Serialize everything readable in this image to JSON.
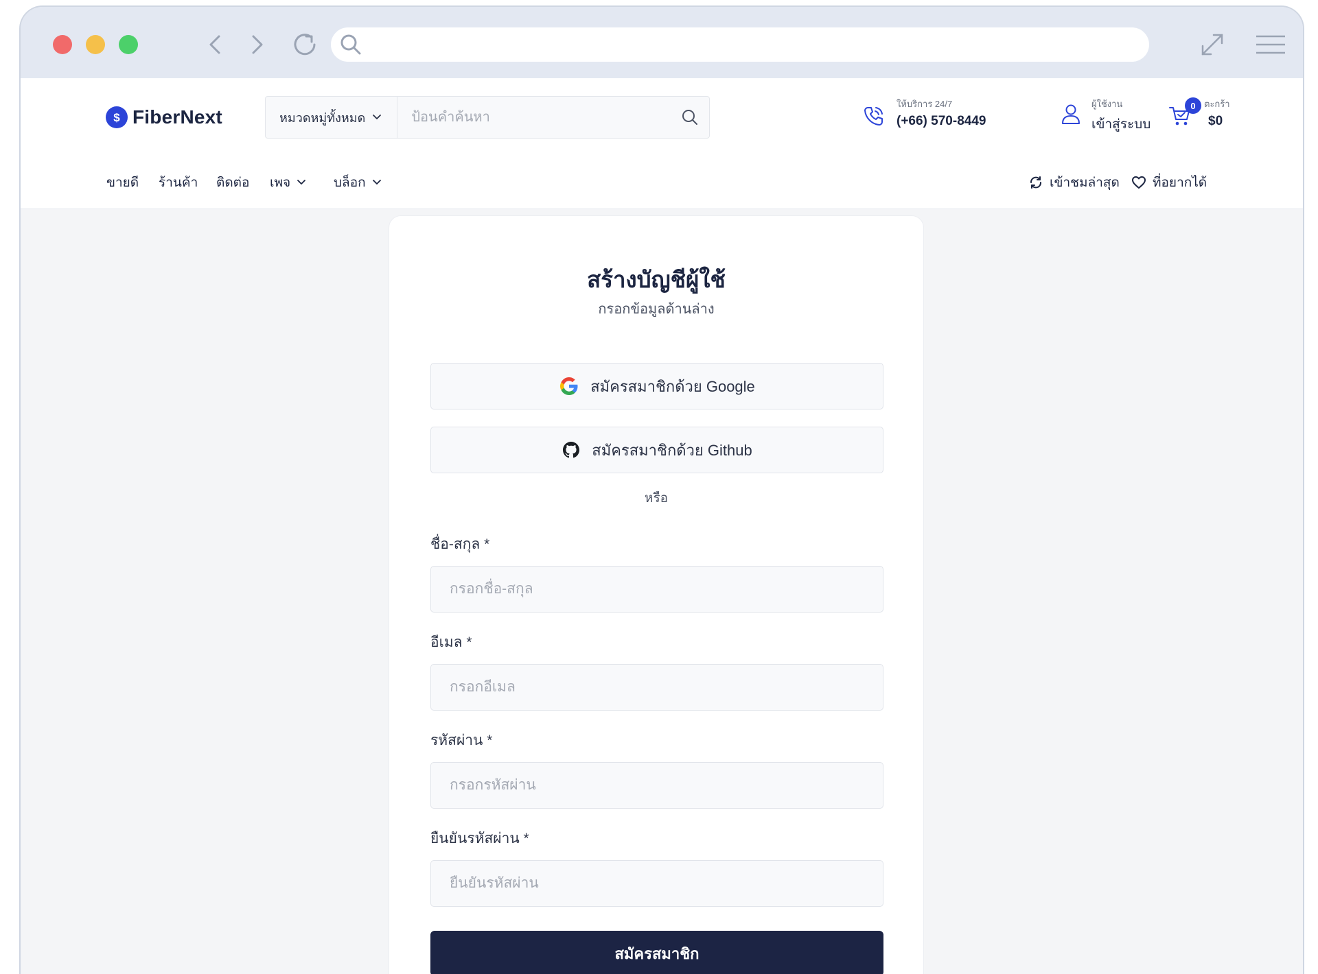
{
  "browser": {
    "url": ""
  },
  "header": {
    "brand": "FiberNext",
    "category_label": "หมวดหมู่ทั้งหมด",
    "search_placeholder": "ป้อนคำค้นหา",
    "support_label": "ให้บริการ 24/7",
    "support_phone": "(+66) 570-8449",
    "user_label": "ผู้ใช้งาน",
    "user_action": "เข้าสู่ระบบ",
    "cart_label": "ตะกร้า",
    "cart_count": "0",
    "cart_total": "$0"
  },
  "nav": {
    "items": [
      "ขายดี",
      "ร้านค้า",
      "ติดต่อ",
      "เพจ",
      "บล็อก"
    ],
    "recent": "เข้าชมล่าสุด",
    "wishlist": "ที่อยากได้"
  },
  "form": {
    "title": "สร้างบัญชีผู้ใช้",
    "subtitle": "กรอกข้อมูลด้านล่าง",
    "google_label": "สมัครสมาชิกด้วย Google",
    "github_label": "สมัครสมาชิกด้วย Github",
    "or_label": "หรือ",
    "fields": [
      {
        "label": "ชื่อ-สกุล *",
        "placeholder": "กรอกชื่อ-สกุล",
        "value": ""
      },
      {
        "label": "อีเมล *",
        "placeholder": "กรอกอีเมล",
        "value": ""
      },
      {
        "label": "รหัสผ่าน *",
        "placeholder": "กรอกรหัสผ่าน",
        "value": ""
      },
      {
        "label": "ยืนยันรหัสผ่าน *",
        "placeholder": "ยืนยันรหัสผ่าน",
        "value": ""
      }
    ],
    "submit_label": "สมัครสมาชิก"
  },
  "colors": {
    "primary": "#1c2444",
    "accent": "#2c44d8",
    "background": "#f4f5f7"
  },
  "icons": [
    "search-icon",
    "back-icon",
    "forward-icon",
    "reload-icon",
    "expand-icon",
    "menu-icon",
    "phone-icon",
    "user-icon",
    "cart-icon",
    "refresh-icon",
    "heart-icon",
    "google-icon",
    "github-icon",
    "chevron-down-icon"
  ]
}
